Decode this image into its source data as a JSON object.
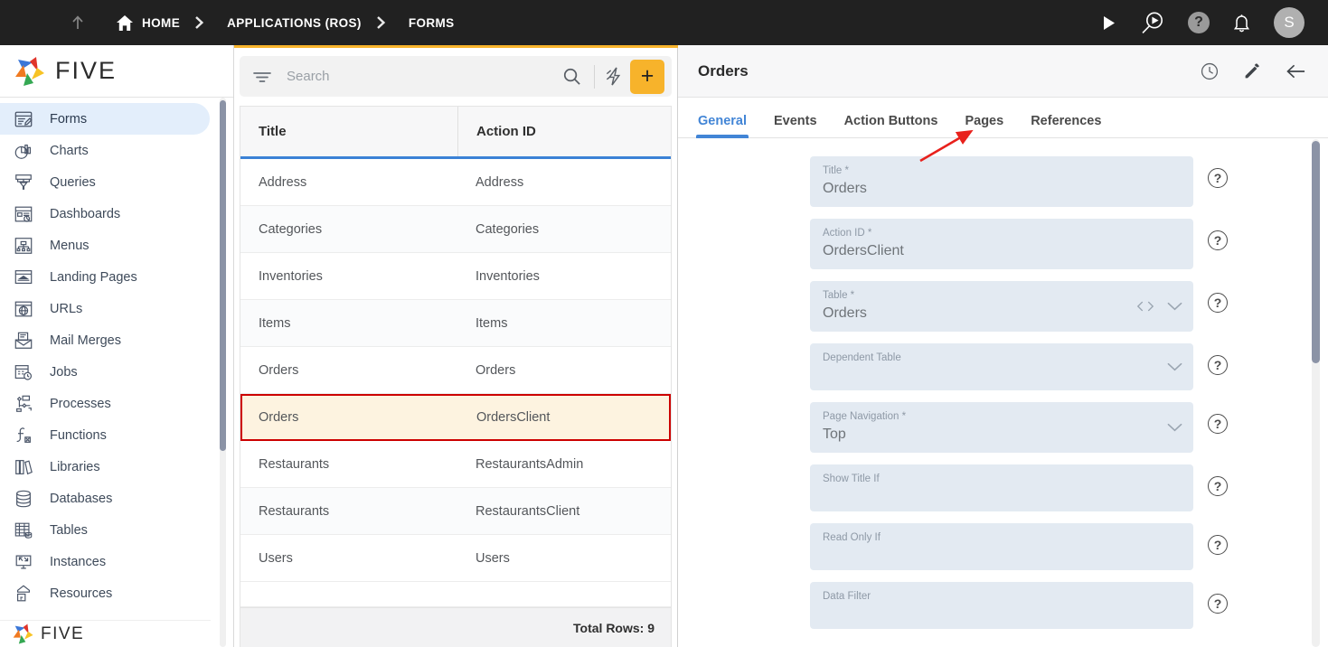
{
  "topbar": {
    "menu_icon": "hamburger-menu-icon",
    "up_icon": "arrow-up-icon",
    "home_icon": "home-icon",
    "breadcrumbs": [
      {
        "label": "HOME",
        "icon": "home-icon"
      },
      {
        "label": "APPLICATIONS (ROS)"
      },
      {
        "label": "FORMS"
      }
    ],
    "separator": "›",
    "actions": [
      {
        "name": "run-icon",
        "glyph": "▶"
      },
      {
        "name": "search-preview-icon",
        "glyph": ""
      },
      {
        "name": "help-icon",
        "glyph": "?"
      },
      {
        "name": "notifications-bell-icon",
        "glyph": ""
      }
    ],
    "avatar_initial": "S",
    "accent_color": "#f7b32b",
    "background_color": "#212121"
  },
  "sidebar": {
    "brand": "FIVE",
    "brand_footer": "FIVE",
    "items": [
      {
        "label": "Forms",
        "icon": "forms-icon",
        "active": true
      },
      {
        "label": "Charts",
        "icon": "charts-icon",
        "active": false
      },
      {
        "label": "Queries",
        "icon": "queries-icon",
        "active": false
      },
      {
        "label": "Dashboards",
        "icon": "dashboards-icon",
        "active": false
      },
      {
        "label": "Menus",
        "icon": "menus-icon",
        "active": false
      },
      {
        "label": "Landing Pages",
        "icon": "landing-pages-icon",
        "active": false
      },
      {
        "label": "URLs",
        "icon": "urls-icon",
        "active": false
      },
      {
        "label": "Mail Merges",
        "icon": "mail-merges-icon",
        "active": false
      },
      {
        "label": "Jobs",
        "icon": "jobs-icon",
        "active": false
      },
      {
        "label": "Processes",
        "icon": "processes-icon",
        "active": false
      },
      {
        "label": "Functions",
        "icon": "functions-icon",
        "active": false
      },
      {
        "label": "Libraries",
        "icon": "libraries-icon",
        "active": false
      },
      {
        "label": "Databases",
        "icon": "databases-icon",
        "active": false
      },
      {
        "label": "Tables",
        "icon": "tables-icon",
        "active": false
      },
      {
        "label": "Instances",
        "icon": "instances-icon",
        "active": false
      },
      {
        "label": "Resources",
        "icon": "resources-icon",
        "active": false
      }
    ],
    "active_highlight_color": "#e3eefb"
  },
  "list_pane": {
    "search": {
      "placeholder": "Search",
      "value": "",
      "filter_icon": "filter-icon",
      "search_icon": "search-icon"
    },
    "quick_action_icon": "lightning-bolt-icon",
    "add_button_label": "+",
    "add_button_color": "#f7b32b",
    "columns": [
      "Title",
      "Action ID"
    ],
    "rows": [
      {
        "title": "Address",
        "action_id": "Address",
        "selected": false
      },
      {
        "title": "Categories",
        "action_id": "Categories",
        "selected": false
      },
      {
        "title": "Inventories",
        "action_id": "Inventories",
        "selected": false
      },
      {
        "title": "Items",
        "action_id": "Items",
        "selected": false
      },
      {
        "title": "Orders",
        "action_id": "Orders",
        "selected": false
      },
      {
        "title": "Orders",
        "action_id": "OrdersClient",
        "selected": true
      },
      {
        "title": "Restaurants",
        "action_id": "RestaurantsAdmin",
        "selected": false
      },
      {
        "title": "Restaurants",
        "action_id": "RestaurantsClient",
        "selected": false
      },
      {
        "title": "Users",
        "action_id": "Users",
        "selected": false
      }
    ],
    "footer_label": "Total Rows: 9",
    "selected_row_border_color": "#cc0000",
    "selected_row_background": "#fdf3e0",
    "header_underline_color": "#3b82d6"
  },
  "detail_pane": {
    "title": "Orders",
    "header_icons": [
      {
        "name": "history-clock-icon"
      },
      {
        "name": "edit-pencil-icon"
      },
      {
        "name": "back-arrow-icon"
      }
    ],
    "tabs": [
      {
        "label": "General",
        "active": true
      },
      {
        "label": "Events",
        "active": false
      },
      {
        "label": "Action Buttons",
        "active": false
      },
      {
        "label": "Pages",
        "active": false
      },
      {
        "label": "References",
        "active": false
      }
    ],
    "active_tab_color": "#4285d6",
    "fields": [
      {
        "label": "Title *",
        "value": "Orders",
        "controls": [],
        "help": "?"
      },
      {
        "label": "Action ID *",
        "value": "OrdersClient",
        "controls": [],
        "help": "?"
      },
      {
        "label": "Table *",
        "value": "Orders",
        "controls": [
          "code-icon",
          "chevron-down-icon"
        ],
        "help": "?"
      },
      {
        "label": "Dependent Table",
        "value": "",
        "controls": [
          "chevron-down-icon"
        ],
        "help": "?"
      },
      {
        "label": "Page Navigation *",
        "value": "Top",
        "controls": [
          "chevron-down-icon"
        ],
        "help": "?"
      },
      {
        "label": "Show Title If",
        "value": "",
        "controls": [],
        "help": "?"
      },
      {
        "label": "Read Only If",
        "value": "",
        "controls": [],
        "help": "?"
      },
      {
        "label": "Data Filter",
        "value": "",
        "controls": [],
        "help": "?"
      }
    ],
    "field_background": "#e3eaf2"
  },
  "annotation": {
    "type": "red-arrow",
    "color": "#e8211c",
    "points_to": "Pages"
  }
}
